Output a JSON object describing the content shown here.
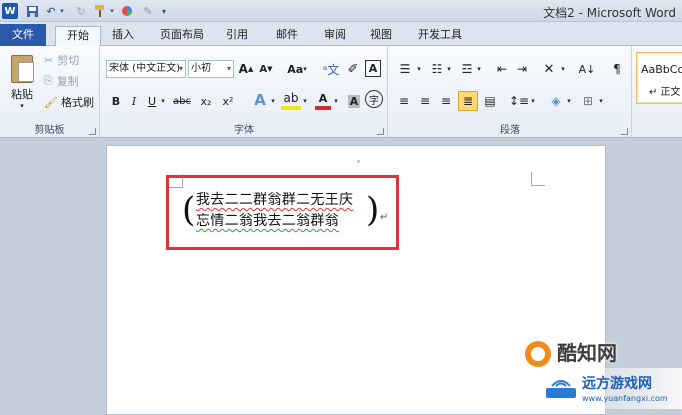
{
  "window": {
    "title": "文档2 - Microsoft Word"
  },
  "quick_access": {
    "save_icon": "save-icon",
    "undo_icon": "undo-icon",
    "redo_icon": "redo-icon"
  },
  "tabs": [
    {
      "label": "文件"
    },
    {
      "label": "开始"
    },
    {
      "label": "插入"
    },
    {
      "label": "页面布局"
    },
    {
      "label": "引用"
    },
    {
      "label": "邮件"
    },
    {
      "label": "审阅"
    },
    {
      "label": "视图"
    },
    {
      "label": "开发工具"
    }
  ],
  "clipboard": {
    "paste": "粘贴",
    "cut": "剪切",
    "copy": "复制",
    "format_painter": "格式刷",
    "group_label": "剪贴板"
  },
  "font": {
    "font_name": "宋体 (中文正文)",
    "font_size": "小初",
    "case_label": "Aa",
    "group_label": "字体",
    "bold": "B",
    "italic": "I",
    "underline": "U",
    "strike": "abc",
    "subscript": "x₂",
    "superscript": "x²",
    "grow": "A",
    "shrink": "A",
    "font_color": "A"
  },
  "paragraph": {
    "group_label": "段落"
  },
  "styles": {
    "preview": "AaBbCc",
    "name": "↵ 正文"
  },
  "document": {
    "line1": "我去二二群翁群二无王庆",
    "line2": "忘情二翁我去二翁群翁",
    "para_mark": "↵"
  },
  "watermark": {
    "brand": "酷知网",
    "sub_brand": "远方游戏网",
    "url": "www.yuanfangxi.com"
  },
  "colors": {
    "file_tab": "#2a5aa8",
    "highlight_box": "#d9393e"
  }
}
